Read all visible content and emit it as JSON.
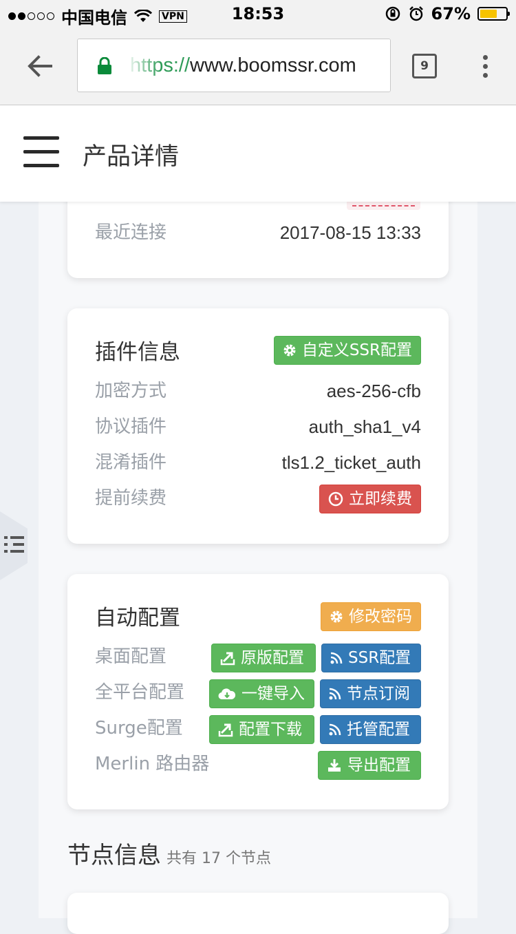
{
  "status_bar": {
    "carrier": "中国电信",
    "vpn": "VPN",
    "time": "18:53",
    "battery": "67%",
    "battery_level": 0.67
  },
  "browser": {
    "url_scheme": "https://",
    "url_host": "www.boomssr.com",
    "tab_count": "9"
  },
  "app_header": {
    "title": "产品详情"
  },
  "top_card": {
    "label": "最近连接",
    "value": "2017-08-15 13:33"
  },
  "plugin_card": {
    "title": "插件信息",
    "custom_button": "自定义SSR配置",
    "rows": [
      {
        "label": "加密方式",
        "value": "aes-256-cfb"
      },
      {
        "label": "协议插件",
        "value": "auth_sha1_v4"
      },
      {
        "label": "混淆插件",
        "value": "tls1.2_ticket_auth"
      }
    ],
    "renew_label": "提前续费",
    "renew_button": "立即续费"
  },
  "auto_card": {
    "title": "自动配置",
    "change_password_button": "修改密码",
    "desktop_label": "桌面配置",
    "desktop_original_button": "原版配置",
    "desktop_ssr_button": "SSR配置",
    "all_platform_label": "全平台配置",
    "import_button": "一键导入",
    "subscribe_button": "节点订阅",
    "surge_label": "Surge配置",
    "surge_download_button": "配置下载",
    "surge_hosted_button": "托管配置",
    "merlin_label": "Merlin 路由器",
    "export_button": "导出配置"
  },
  "nodes_section": {
    "title": "节点信息",
    "subtitle": "共有 17 个节点"
  },
  "colors": {
    "green": "#5cb85c",
    "blue": "#337ab7",
    "red": "#d9534f",
    "orange": "#f0ad4e"
  }
}
